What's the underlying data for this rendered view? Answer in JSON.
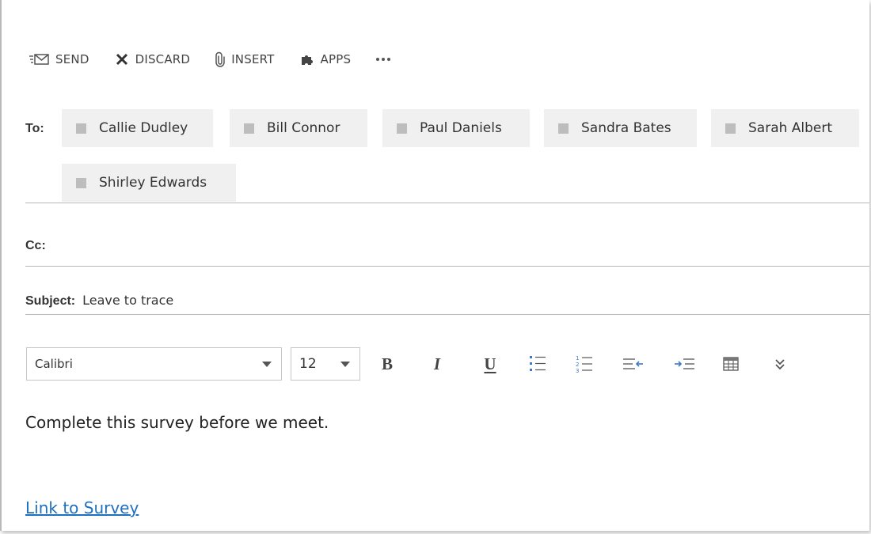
{
  "toolbar": {
    "send_label": "SEND",
    "discard_label": "DISCARD",
    "insert_label": "INSERT",
    "apps_label": "APPS",
    "icons": {
      "send": "send-mail-icon",
      "discard": "close-x-icon",
      "insert": "paperclip-icon",
      "apps": "puzzle-icon",
      "more": "more-ellipsis-icon"
    }
  },
  "to": {
    "label": "To:",
    "recipients": [
      "Callie Dudley",
      "Bill Connor",
      "Paul Daniels",
      "Sandra Bates",
      "Sarah Albert",
      "Shirley Edwards"
    ]
  },
  "cc": {
    "label": "Cc:"
  },
  "subject": {
    "label": "Subject:",
    "value": "Leave to trace"
  },
  "format": {
    "font_name": "Calibri",
    "font_size": "12",
    "bold_label": "B",
    "italic_label": "I",
    "underline_label": "U"
  },
  "body": {
    "text": "Complete this survey before we meet.",
    "link_text": "Link to Survey"
  },
  "colors": {
    "link": "#1f6fc1",
    "chip_background": "#f0f0f0",
    "chip_marker": "#bdbdbd",
    "list_icon_blue": "#3c78c3"
  }
}
